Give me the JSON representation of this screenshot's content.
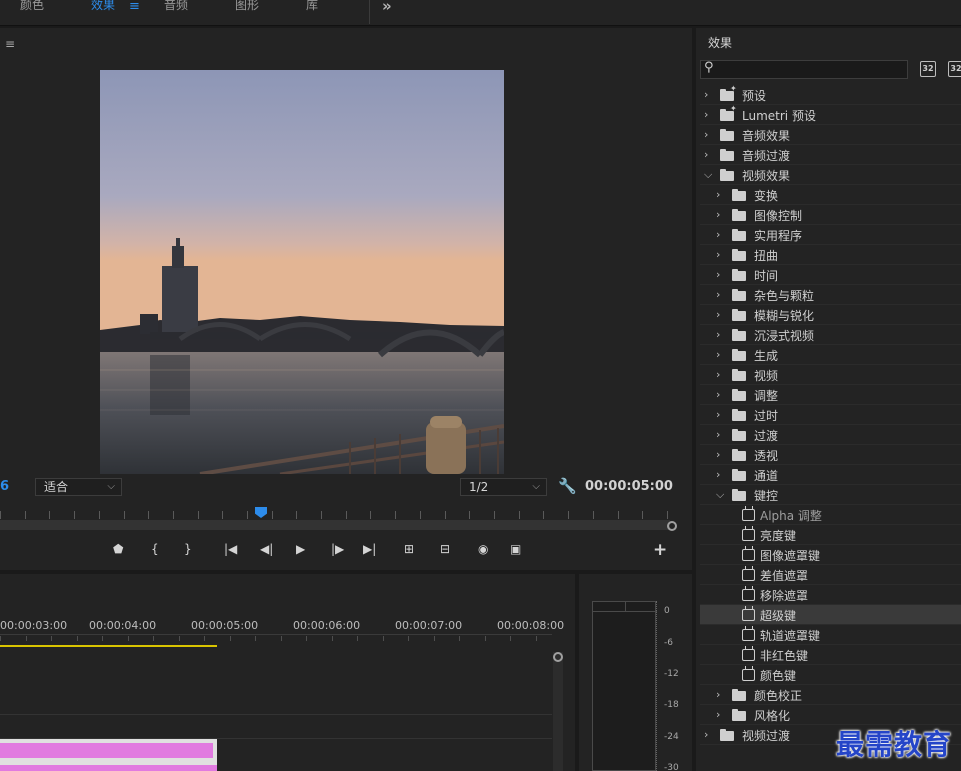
{
  "workspace_tabs": [
    {
      "label": "颜色",
      "active": false
    },
    {
      "label": "效果",
      "active": true
    },
    {
      "label": "音频",
      "active": false
    },
    {
      "label": "图形",
      "active": false
    },
    {
      "label": "库",
      "active": false
    }
  ],
  "program_monitor": {
    "timecode_left": "6",
    "zoom_value": "适合",
    "resolution_value": "1/2",
    "timecode_right": "00:00:05:00",
    "playhead_fraction": 0.387
  },
  "timeline": {
    "time_labels": [
      "00:00:03:00",
      "00:00:04:00",
      "00:00:05:00",
      "00:00:06:00",
      "00:00:07:00",
      "00:00:08:00"
    ]
  },
  "audio_meter": {
    "db_labels": [
      "0",
      "-6",
      "-12",
      "-18",
      "-24",
      "-30"
    ]
  },
  "effects_panel": {
    "title": "效果",
    "search_placeholder": "",
    "button_labels": [
      "32",
      "32"
    ],
    "items": [
      {
        "label": "预设",
        "level": 0,
        "type": "folder-star",
        "expanded": false
      },
      {
        "label": "Lumetri 预设",
        "level": 0,
        "type": "folder-star",
        "expanded": false
      },
      {
        "label": "音频效果",
        "level": 0,
        "type": "folder",
        "expanded": false
      },
      {
        "label": "音频过渡",
        "level": 0,
        "type": "folder",
        "expanded": false
      },
      {
        "label": "视频效果",
        "level": 0,
        "type": "folder",
        "expanded": true
      },
      {
        "label": "变换",
        "level": 1,
        "type": "folder",
        "expanded": false
      },
      {
        "label": "图像控制",
        "level": 1,
        "type": "folder",
        "expanded": false
      },
      {
        "label": "实用程序",
        "level": 1,
        "type": "folder",
        "expanded": false
      },
      {
        "label": "扭曲",
        "level": 1,
        "type": "folder",
        "expanded": false
      },
      {
        "label": "时间",
        "level": 1,
        "type": "folder",
        "expanded": false
      },
      {
        "label": "杂色与颗粒",
        "level": 1,
        "type": "folder",
        "expanded": false
      },
      {
        "label": "模糊与锐化",
        "level": 1,
        "type": "folder",
        "expanded": false
      },
      {
        "label": "沉浸式视频",
        "level": 1,
        "type": "folder",
        "expanded": false
      },
      {
        "label": "生成",
        "level": 1,
        "type": "folder",
        "expanded": false
      },
      {
        "label": "视频",
        "level": 1,
        "type": "folder",
        "expanded": false
      },
      {
        "label": "调整",
        "level": 1,
        "type": "folder",
        "expanded": false
      },
      {
        "label": "过时",
        "level": 1,
        "type": "folder",
        "expanded": false
      },
      {
        "label": "过渡",
        "level": 1,
        "type": "folder",
        "expanded": false
      },
      {
        "label": "透视",
        "level": 1,
        "type": "folder",
        "expanded": false
      },
      {
        "label": "通道",
        "level": 1,
        "type": "folder",
        "expanded": false
      },
      {
        "label": "键控",
        "level": 1,
        "type": "folder",
        "expanded": true
      },
      {
        "label": "Alpha 调整",
        "level": 2,
        "type": "effect",
        "dim": true
      },
      {
        "label": "亮度键",
        "level": 2,
        "type": "effect"
      },
      {
        "label": "图像遮罩键",
        "level": 2,
        "type": "effect"
      },
      {
        "label": "差值遮罩",
        "level": 2,
        "type": "effect"
      },
      {
        "label": "移除遮罩",
        "level": 2,
        "type": "effect"
      },
      {
        "label": "超级键",
        "level": 2,
        "type": "effect",
        "selected": true
      },
      {
        "label": "轨道遮罩键",
        "level": 2,
        "type": "effect"
      },
      {
        "label": "非红色键",
        "level": 2,
        "type": "effect"
      },
      {
        "label": "颜色键",
        "level": 2,
        "type": "effect"
      },
      {
        "label": "颜色校正",
        "level": 1,
        "type": "folder",
        "expanded": false
      },
      {
        "label": "风格化",
        "level": 1,
        "type": "folder",
        "expanded": false
      },
      {
        "label": "视频过渡",
        "level": 0,
        "type": "folder",
        "expanded": false
      }
    ]
  },
  "watermark": "最需教育",
  "colors": {
    "accent": "#2d8ceb",
    "clip": "#e17ae0",
    "work_area": "#d9c400"
  }
}
